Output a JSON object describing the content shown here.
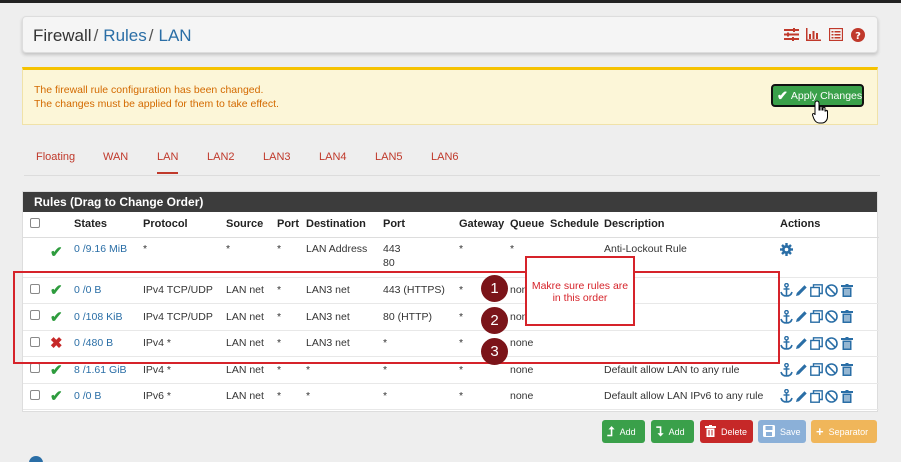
{
  "breadcrumb": {
    "root": "Firewall",
    "section": "Rules",
    "page": "LAN",
    "sep": "/"
  },
  "header_icons": [
    "sliders-icon",
    "bar-chart-icon",
    "list-icon",
    "help-icon"
  ],
  "alert": {
    "line1": "The firewall rule configuration has been changed.",
    "line2": "The changes must be applied for them to take effect.",
    "apply_label": "Apply Changes"
  },
  "tabs": [
    {
      "label": "Floating"
    },
    {
      "label": "WAN"
    },
    {
      "label": "LAN",
      "active": true
    },
    {
      "label": "LAN2"
    },
    {
      "label": "LAN3"
    },
    {
      "label": "LAN4"
    },
    {
      "label": "LAN5"
    },
    {
      "label": "LAN6"
    }
  ],
  "panel_title": "Rules (Drag to Change Order)",
  "columns": {
    "states": "States",
    "protocol": "Protocol",
    "source": "Source",
    "port": "Port",
    "destination": "Destination",
    "dport": "Port",
    "gateway": "Gateway",
    "queue": "Queue",
    "schedule": "Schedule",
    "description": "Description",
    "actions": "Actions"
  },
  "rows": [
    {
      "status": "pass",
      "states": "0 /9.16 MiB",
      "protocol": "*",
      "source": "*",
      "port": "*",
      "destination": "LAN Address",
      "dport": "443",
      "dport2": "80",
      "gateway": "*",
      "queue": "*",
      "schedule": "",
      "description": "Anti-Lockout Rule"
    },
    {
      "status": "pass",
      "states": "0 /0 B",
      "protocol": "IPv4 TCP/UDP",
      "source": "LAN net",
      "port": "*",
      "destination": "LAN3 net",
      "dport": "443 (HTTPS)",
      "gateway": "*",
      "queue": "none",
      "schedule": "",
      "description": ""
    },
    {
      "status": "pass",
      "states": "0 /108 KiB",
      "protocol": "IPv4 TCP/UDP",
      "source": "LAN net",
      "port": "*",
      "destination": "LAN3 net",
      "dport": "80 (HTTP)",
      "gateway": "*",
      "queue": "none",
      "schedule": "",
      "description": ""
    },
    {
      "status": "block",
      "states": "0 /480 B",
      "protocol": "IPv4 *",
      "source": "LAN net",
      "port": "*",
      "destination": "LAN3 net",
      "dport": "*",
      "gateway": "*",
      "queue": "none",
      "schedule": "",
      "description": ""
    },
    {
      "status": "pass",
      "states": "8 /1.61 GiB",
      "protocol": "IPv4 *",
      "source": "LAN net",
      "port": "*",
      "destination": "*",
      "dport": "*",
      "gateway": "*",
      "queue": "none",
      "schedule": "",
      "description": "Default allow LAN to any rule"
    },
    {
      "status": "pass",
      "states": "0 /0 B",
      "protocol": "IPv6 *",
      "source": "LAN net",
      "port": "*",
      "destination": "*",
      "dport": "*",
      "gateway": "*",
      "queue": "none",
      "schedule": "",
      "description": "Default allow LAN IPv6 to any rule"
    }
  ],
  "annotation": {
    "callout": "Makre sure rules are in this order",
    "numbers": [
      "1",
      "2",
      "3"
    ]
  },
  "buttons": {
    "add_top": "Add",
    "add_bottom": "Add",
    "delete": "Delete",
    "save": "Save",
    "separator": "Separator"
  },
  "colors": {
    "link": "#2a6ea6",
    "pass": "#2e9c3e",
    "block": "#c62828",
    "annotation": "#d6232a",
    "tab_active": "#c0392b"
  }
}
